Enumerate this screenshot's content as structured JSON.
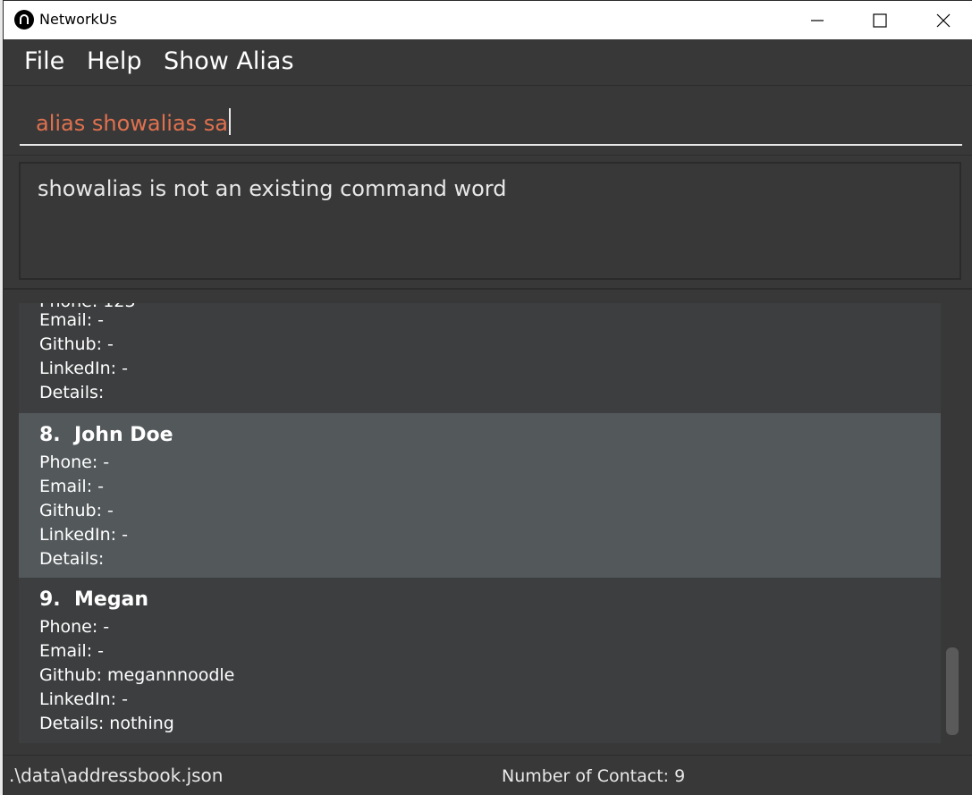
{
  "window": {
    "title": "NetworkUs",
    "app_icon": "app-logo-icon"
  },
  "controls": {
    "minimize_icon": "minimize-icon",
    "maximize_icon": "maximize-icon",
    "close_icon": "close-icon"
  },
  "menu": {
    "items": [
      "File",
      "Help",
      "Show Alias"
    ]
  },
  "command": {
    "value": "alias showalias sa"
  },
  "result": {
    "message": "showalias is not an existing command word"
  },
  "contacts": [
    {
      "partial_top": "Phone: 123 ·",
      "email": "Email: -",
      "github": "Github: -",
      "linkedin": "LinkedIn: -",
      "details": "Details:"
    },
    {
      "index": "8.",
      "name": "John Doe",
      "phone": "Phone: -",
      "email": "Email: -",
      "github": "Github: -",
      "linkedin": "LinkedIn: -",
      "details": "Details:",
      "selected": true
    },
    {
      "index": "9.",
      "name": "Megan",
      "phone": "Phone: -",
      "email": "Email: -",
      "github": "Github: megannnoodle",
      "linkedin": "LinkedIn: -",
      "details": "Details: nothing"
    }
  ],
  "status": {
    "path": ".\\data\\addressbook.json",
    "count": "Number of Contact: 9"
  },
  "colors": {
    "command_text": "#e0714f",
    "background": "#383838",
    "selected_card": "#53585b"
  }
}
